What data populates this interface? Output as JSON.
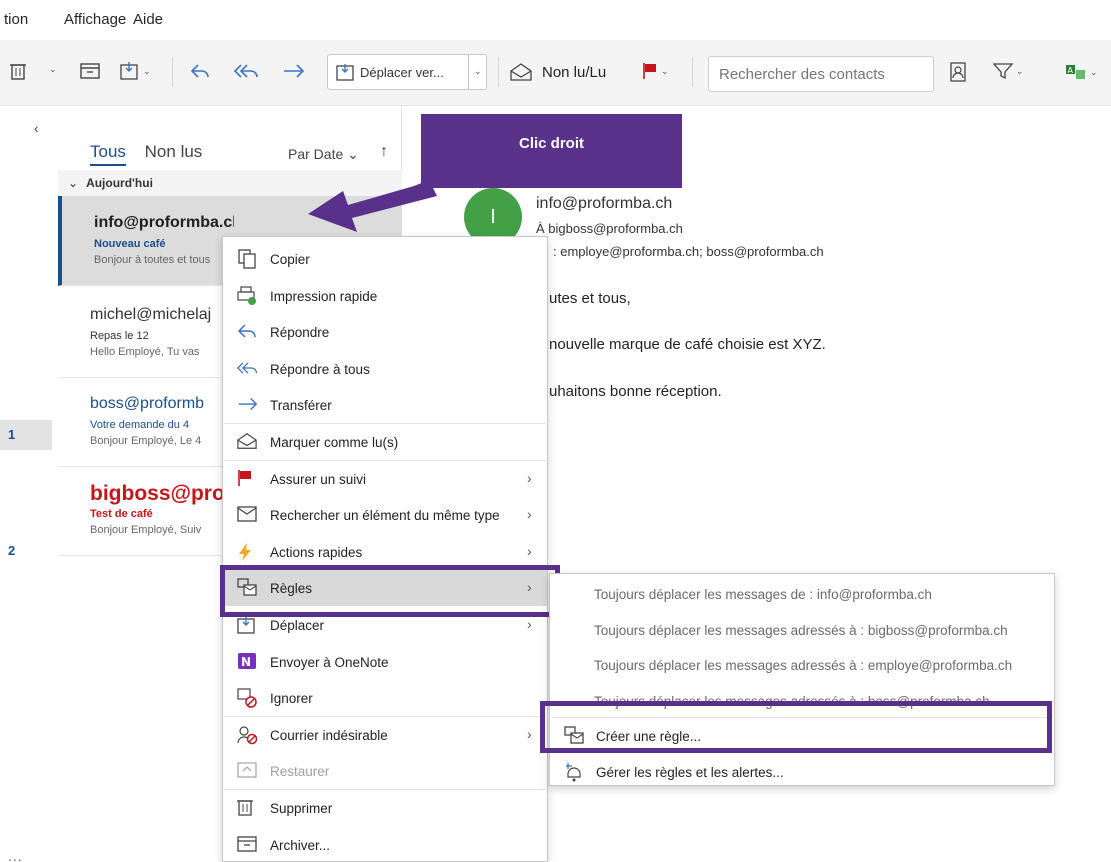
{
  "menubar": [
    "tion",
    "Affichage",
    "Aide"
  ],
  "toolbar": {
    "move_label": "Déplacer ver...",
    "read_unread_label": "Non lu/Lu",
    "search_placeholder": "Rechercher des contacts",
    "accent": "#3b74c5"
  },
  "nav": {
    "badges": [
      "1",
      "2"
    ],
    "more": "..."
  },
  "list": {
    "tab_all": "Tous",
    "tab_unread": "Non lus",
    "sort_label": "Par Date",
    "group": "Aujourd'hui",
    "messages": [
      {
        "from": "info@proformba.ch",
        "subject": "Nouveau café",
        "preview": "Bonjour à toutes et tous",
        "from_color": "#1f1f1f",
        "subject_color": "#1a4f8b",
        "bold": true,
        "selected": true
      },
      {
        "from": "michel@michelaj",
        "subject": "Repas le 12",
        "preview": "Hello Employé,  Tu vas",
        "from_color": "#333333",
        "subject_color": "#333333",
        "bold": false,
        "selected": false
      },
      {
        "from": "boss@proformb",
        "subject": "Votre demande du 4",
        "preview": "Bonjour Employé,  Le 4",
        "from_color": "#1a4f8b",
        "subject_color": "#1a4f8b",
        "bold": false,
        "selected": false
      },
      {
        "from": "bigboss@pro",
        "subject": "Test de café",
        "preview": "Bonjour Employé,  Suiv",
        "from_color": "#c4161c",
        "subject_color": "#c4161c",
        "bold": true,
        "selected": false
      }
    ]
  },
  "reading": {
    "avatar_letter": "I",
    "from": "info@proformba.ch",
    "to": "À   bigboss@proformba.ch",
    "cc": ":  employe@proformba.ch; boss@proformba.ch",
    "body": [
      "utes et tous,",
      "nouvelle marque de café choisie est XYZ.",
      "uhaitons bonne réception."
    ]
  },
  "callout": {
    "text": "Clic droit",
    "color": "#59308a"
  },
  "context_menu": [
    {
      "label": "Copier",
      "icon": "copy-icon",
      "submenu": false
    },
    {
      "label": "Impression rapide",
      "icon": "quick-print-icon",
      "submenu": false
    },
    {
      "label": "Répondre",
      "icon": "reply-icon",
      "submenu": false
    },
    {
      "label": "Répondre à tous",
      "icon": "reply-all-icon",
      "submenu": false
    },
    {
      "label": "Transférer",
      "icon": "forward-icon",
      "submenu": false
    },
    {
      "label": "Marquer comme lu(s)",
      "icon": "envelope-open-icon",
      "submenu": false
    },
    {
      "label": "Assurer un suivi",
      "icon": "flag-icon",
      "submenu": true
    },
    {
      "label": "Rechercher un élément du même type",
      "icon": "find-related-icon",
      "submenu": true
    },
    {
      "label": "Actions rapides",
      "icon": "lightning-icon",
      "submenu": true
    },
    {
      "label": "Règles",
      "icon": "rules-icon",
      "submenu": true,
      "highlighted": true
    },
    {
      "label": "Déplacer",
      "icon": "move-icon",
      "submenu": true
    },
    {
      "label": "Envoyer à OneNote",
      "icon": "onenote-icon",
      "submenu": false
    },
    {
      "label": "Ignorer",
      "icon": "ignore-icon",
      "submenu": false
    },
    {
      "label": "Courrier indésirable",
      "icon": "junk-icon",
      "submenu": true
    },
    {
      "label": "Restaurer",
      "icon": "restore-icon",
      "submenu": false,
      "disabled": true
    },
    {
      "label": "Supprimer",
      "icon": "trash-icon",
      "submenu": false
    },
    {
      "label": "Archiver...",
      "icon": "archive-icon",
      "submenu": false
    }
  ],
  "rules_submenu": [
    {
      "label": "Toujours déplacer les messages de : info@proformba.ch"
    },
    {
      "label": "Toujours déplacer les messages adressés à : bigboss@proformba.ch"
    },
    {
      "label": "Toujours déplacer les messages adressés à : employe@proformba.ch"
    },
    {
      "label": "Toujours déplacer les messages adressés à : boss@proformba.ch"
    },
    {
      "label": "Créer une règle...",
      "icon": "create-rule-icon"
    },
    {
      "label": "Gérer les règles et les alertes...",
      "icon": "manage-rules-icon"
    }
  ]
}
